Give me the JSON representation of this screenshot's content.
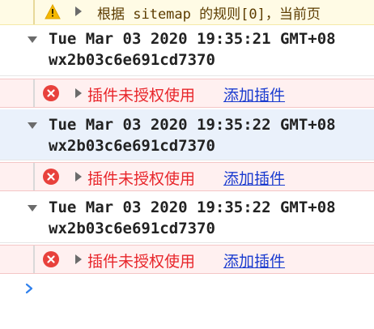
{
  "warning": {
    "icon": "warning-icon",
    "text": "根据 sitemap 的规则[0]，当前页"
  },
  "groups": [
    {
      "timestamp": "Tue Mar 03 2020 19:35:21 GMT+08",
      "appid": "wx2b03c6e691cd7370",
      "error": {
        "message": "插件未授权使用",
        "link": "添加插件"
      }
    },
    {
      "timestamp": "Tue Mar 03 2020 19:35:22 GMT+08",
      "appid": "wx2b03c6e691cd7370",
      "error": {
        "message": "插件未授权使用",
        "link": "添加插件"
      }
    },
    {
      "timestamp": "Tue Mar 03 2020 19:35:22 GMT+08",
      "appid": "wx2b03c6e691cd7370",
      "error": {
        "message": "插件未授权使用",
        "link": "添加插件"
      }
    }
  ],
  "colors": {
    "error": "#e8262b",
    "link": "#1a3bcf",
    "warning_bg": "#fffbe5",
    "selected_bg": "#eaf1fb",
    "prompt": "#2f80ed"
  }
}
